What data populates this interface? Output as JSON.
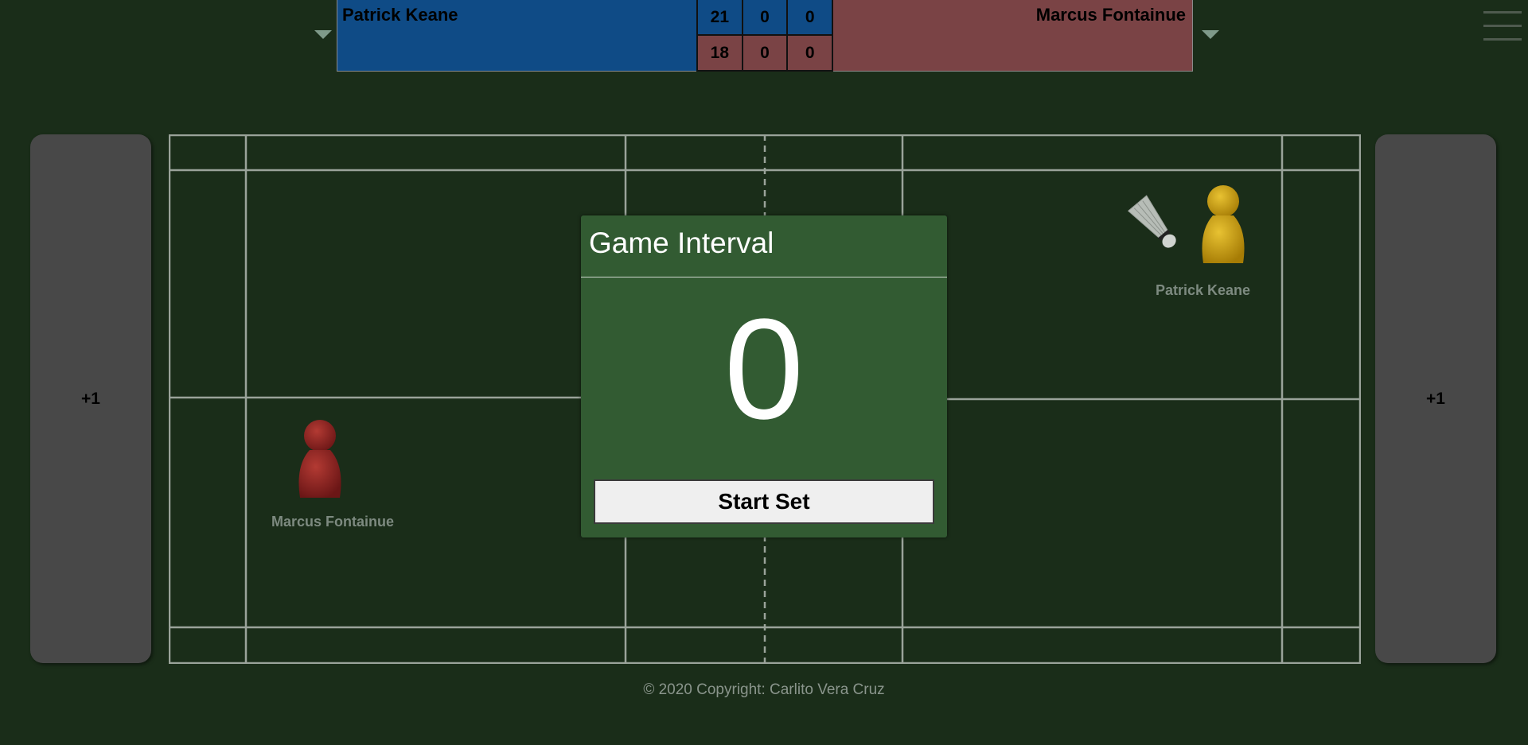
{
  "scoreboard": {
    "left_team": "Patrick Keane",
    "right_team": "Marcus Fontainue",
    "top_row": [
      "21",
      "0",
      "0"
    ],
    "bottom_row": [
      "18",
      "0",
      "0"
    ],
    "left_color": "#0f4b86",
    "right_color": "#7a4345"
  },
  "side_panels": {
    "left_label": "+1",
    "right_label": "+1"
  },
  "players": {
    "left_name": "Marcus Fontainue",
    "left_color": "#8b2323",
    "right_name": "Patrick Keane",
    "right_color": "#d4a60e"
  },
  "modal": {
    "title": "Game Interval",
    "count": "0",
    "button_label": "Start Set"
  },
  "footer": {
    "copyright": "© 2020 Copyright: Carlito Vera Cruz"
  },
  "icons": [
    "chevron-down-icon",
    "hamburger-menu-icon",
    "shuttlecock-icon",
    "player-pawn-icon"
  ]
}
